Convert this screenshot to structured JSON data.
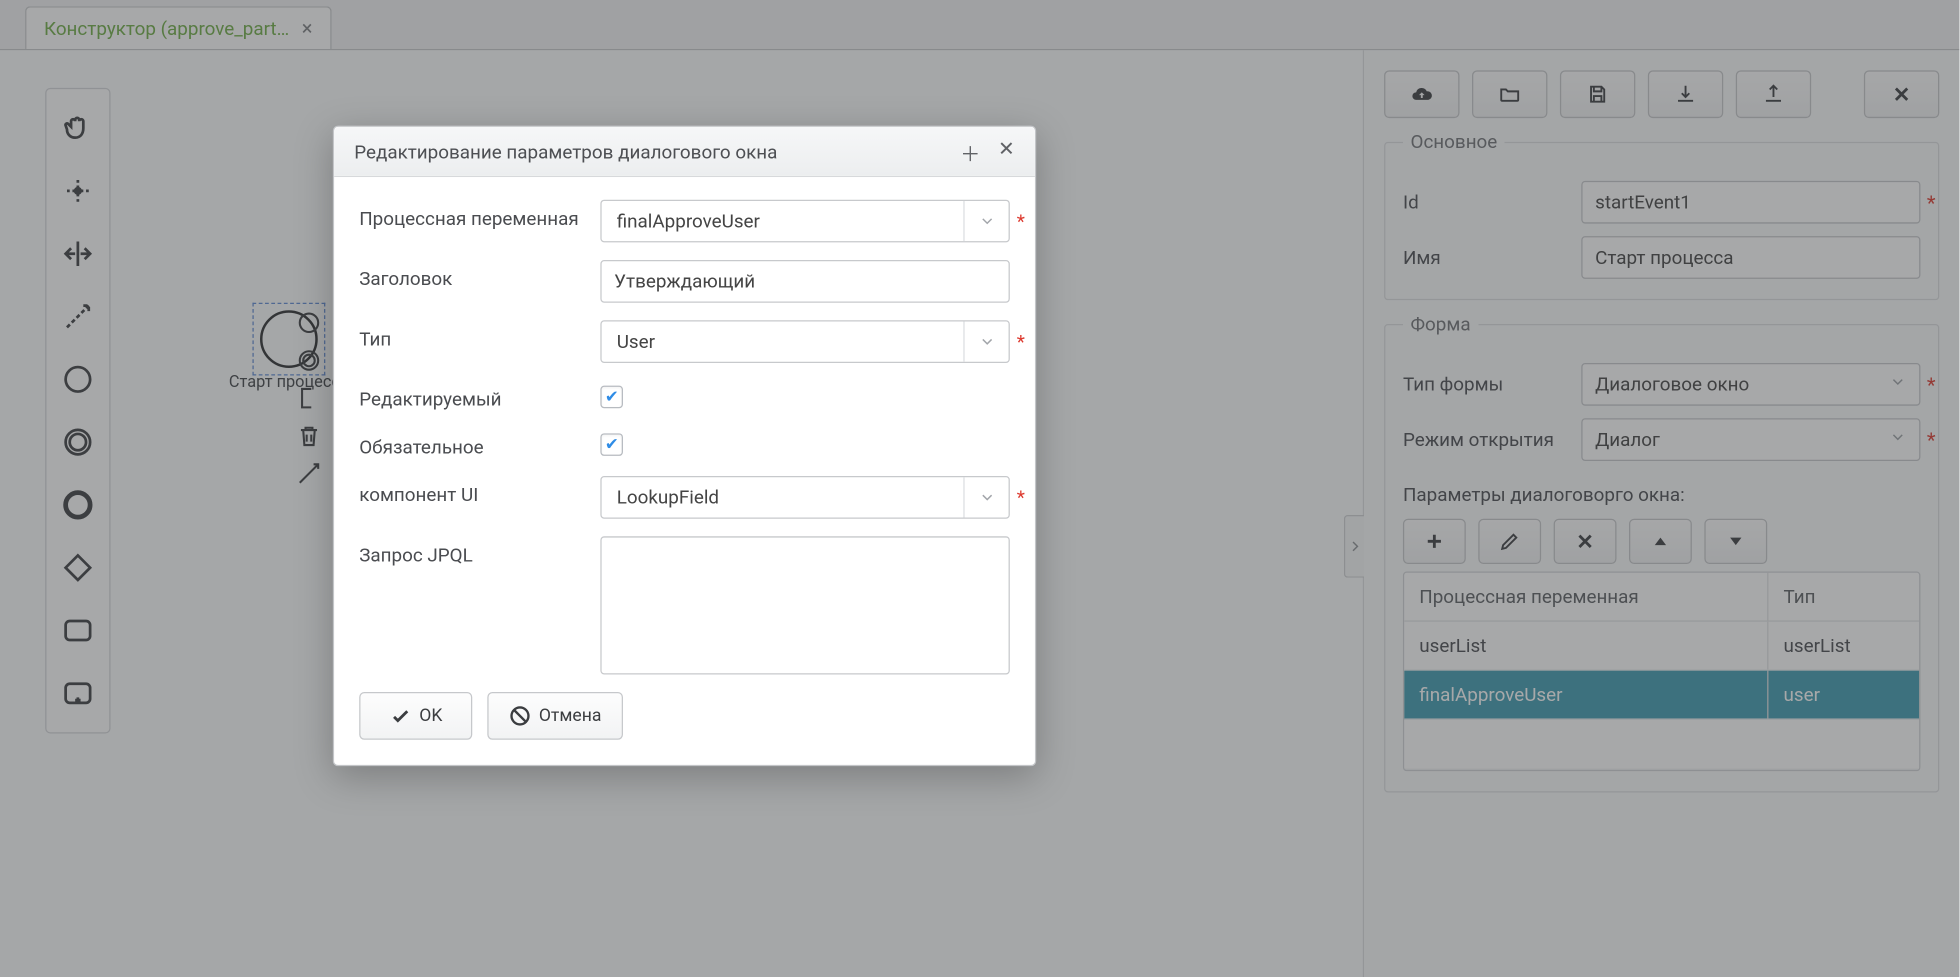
{
  "tab": {
    "title": "Конструктор (approve_part…"
  },
  "start_node": {
    "label": "Старт процесса"
  },
  "right": {
    "main_legend": "Основное",
    "id_label": "Id",
    "id_value": "startEvent1",
    "name_label": "Имя",
    "name_value": "Старт процесса",
    "form_legend": "Форма",
    "form_type_label": "Тип формы",
    "form_type_value": "Диалоговое окно",
    "open_mode_label": "Режим открытия",
    "open_mode_value": "Диалог",
    "params_label": "Параметры диалоговорго окна:",
    "th_variable": "Процессная переменная",
    "th_type": "Тип",
    "rows": [
      {
        "variable": "userList",
        "type": "userList"
      },
      {
        "variable": "finalApproveUser",
        "type": "user"
      }
    ]
  },
  "modal": {
    "title": "Редактирование параметров диалогового окна",
    "process_var_label": "Процессная переменная",
    "process_var_value": "finalApproveUser",
    "header_label": "Заголовок",
    "header_value": "Утверждающий",
    "type_label": "Тип",
    "type_value": "User",
    "editable_label": "Редактируемый",
    "required_label": "Обязательное",
    "ui_comp_label": "компонент UI",
    "ui_comp_value": "LookupField",
    "jpql_label": "Запрос JPQL",
    "ok": "OK",
    "cancel": "Отмена"
  }
}
